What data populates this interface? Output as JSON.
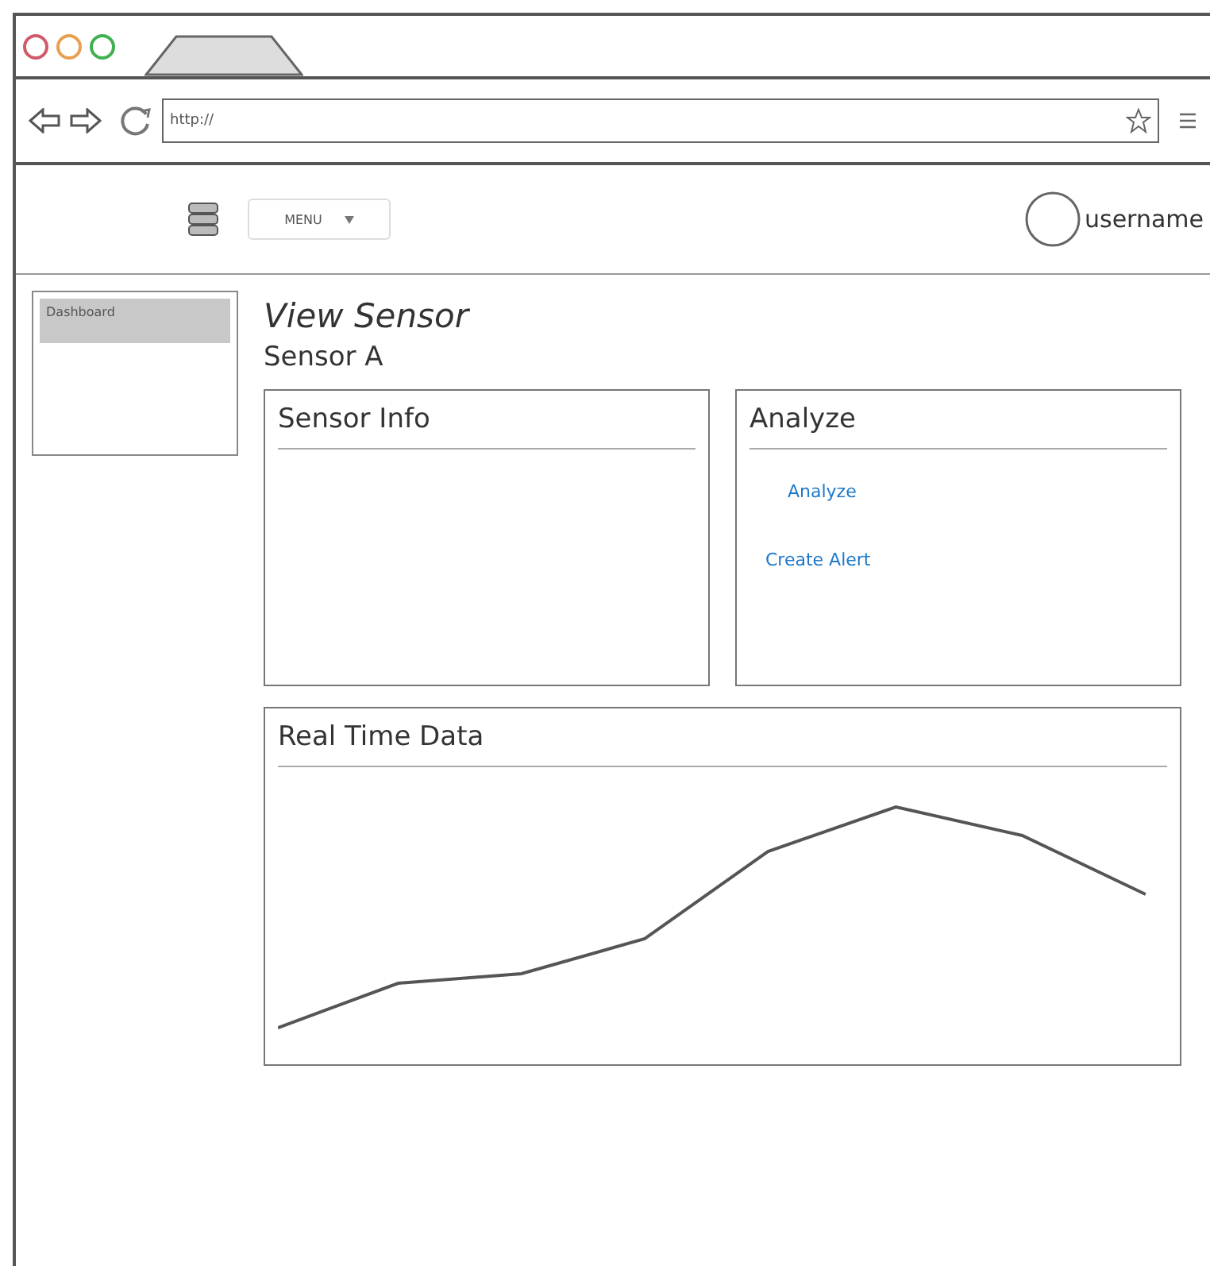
{
  "browser": {
    "address": "http://"
  },
  "header": {
    "menu": "MENU",
    "username": "username"
  },
  "sidebar": {
    "items": [
      {
        "label": "Dashboard",
        "selected": true
      }
    ]
  },
  "page": {
    "title": "View Sensor",
    "subtitle": "Sensor A"
  },
  "panels": [
    {
      "kind": "info",
      "title": "Sensor Info"
    },
    {
      "kind": "links",
      "title": "Analyze",
      "links": [
        "Analyze",
        "Create Alert"
      ]
    },
    {
      "kind": "chart",
      "title": "Real Time Data"
    }
  ]
}
